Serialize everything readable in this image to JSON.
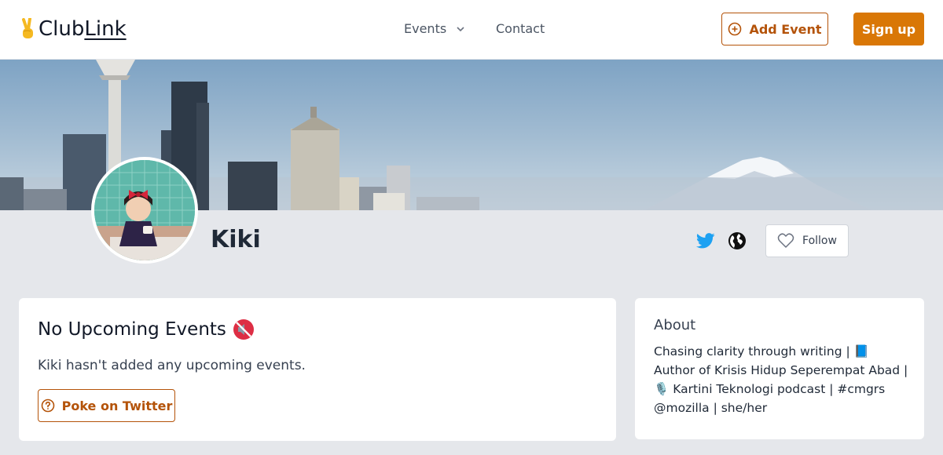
{
  "header": {
    "logo_emoji": "✌",
    "logo_club": "Club",
    "logo_link": "Link",
    "nav": {
      "events_label": "Events",
      "contact_label": "Contact"
    },
    "add_event_label": "Add Event",
    "signup_label": "Sign up"
  },
  "profile": {
    "name": "Kiki",
    "follow_label": "Follow",
    "icons": {
      "twitter": "twitter-icon",
      "globe": "globe-icon",
      "follow": "heart-icon"
    }
  },
  "events_card": {
    "title": "No Upcoming Events",
    "title_icon": "muted-speaker-icon",
    "message": "Kiki hasn't added any upcoming events.",
    "poke_label": "Poke on Twitter"
  },
  "about_card": {
    "title": "About",
    "bio": "Chasing clarity through writing | 📘 Author of Krisis Hidup Seperempat Abad | 🎙️ Kartini Teknologi podcast | #cmgrs @mozilla | she/her"
  },
  "colors": {
    "accent": "#d97706",
    "accent_dark": "#b45309",
    "twitter_blue": "#1da1f2",
    "page_bg": "#e5e7eb"
  }
}
